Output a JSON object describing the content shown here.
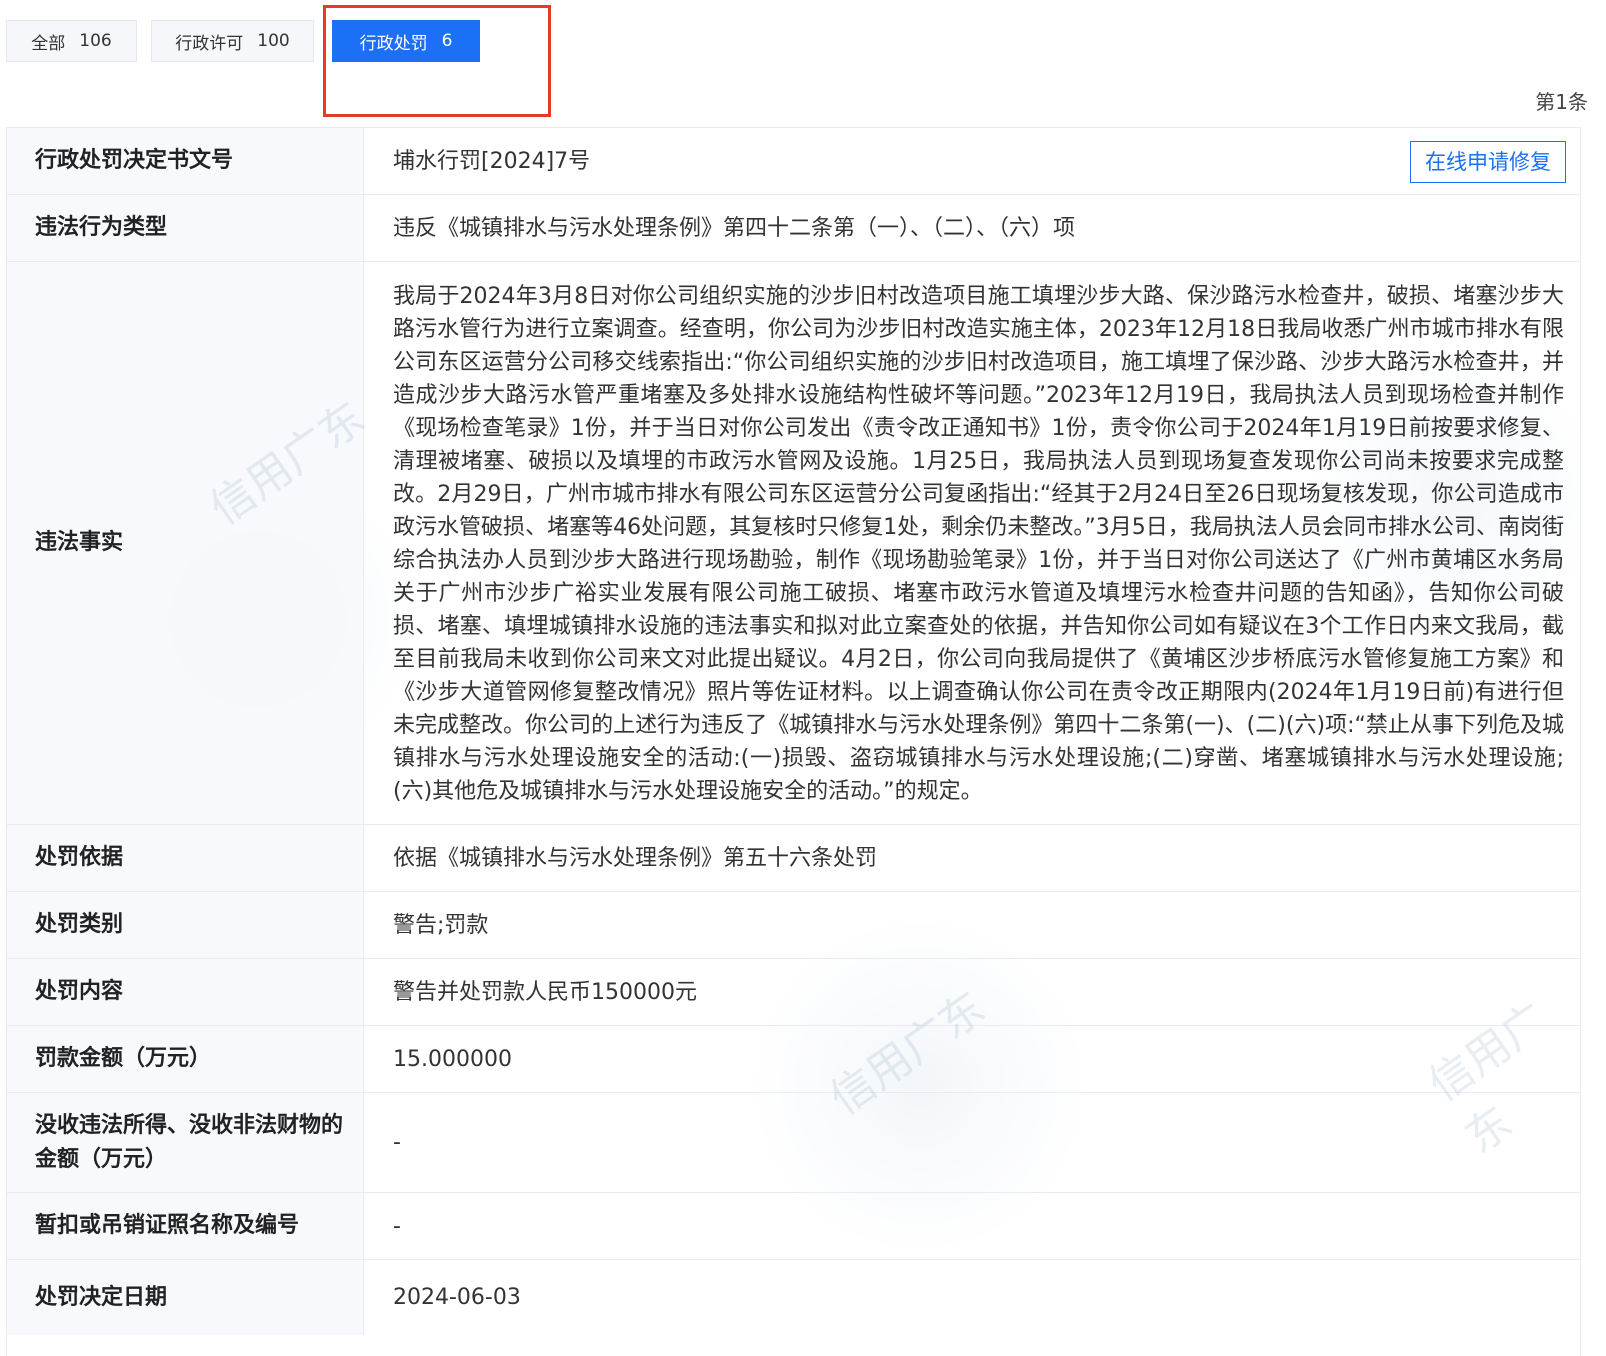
{
  "tabs": [
    {
      "label": "全部",
      "count": "106"
    },
    {
      "label": "行政许可",
      "count": "100"
    },
    {
      "label": "行政处罚",
      "count": "6",
      "active": true
    }
  ],
  "record_count": "第1条",
  "repair_button": "在线申请修复",
  "watermark_text": "信用广东",
  "rows": [
    {
      "label": "行政处罚决定书文号",
      "value": "埔水行罚[2024]7号"
    },
    {
      "label": "违法行为类型",
      "value": "违反《城镇排水与污水处理条例》第四十二条第（一）、（二）、（六）项"
    },
    {
      "label": "违法事实",
      "value": "我局于2024年3月8日对你公司组织实施的沙步旧村改造项目施工填埋沙步大路、保沙路污水检查井，破损、堵塞沙步大路污水管行为进行立案调查。经查明，你公司为沙步旧村改造实施主体，2023年12月18日我局收悉广州市城市排水有限公司东区运营分公司移交线索指出:“你公司组织实施的沙步旧村改造项目，施工填埋了保沙路、沙步大路污水检查井，并造成沙步大路污水管严重堵塞及多处排水设施结构性破坏等问题。”2023年12月19日，我局执法人员到现场检查并制作《现场检查笔录》1份，并于当日对你公司发出《责令改正通知书》1份，责令你公司于2024年1月19日前按要求修复、清理被堵塞、破损以及填埋的市政污水管网及设施。1月25日，我局执法人员到现场复查发现你公司尚未按要求完成整改。2月29日，广州市城市排水有限公司东区运营分公司复函指出:“经其于2月24日至26日现场复核发现，你公司造成市政污水管破损、堵塞等46处问题，其复核时只修复1处，剩余仍未整改。”3月5日，我局执法人员会同市排水公司、南岗街综合执法办人员到沙步大路进行现场勘验，制作《现场勘验笔录》1份，并于当日对你公司送达了《广州市黄埔区水务局关于广州市沙步广裕实业发展有限公司施工破损、堵塞市政污水管道及填埋污水检查井问题的告知函》，告知你公司破损、堵塞、填埋城镇排水设施的违法事实和拟对此立案查处的依据，并告知你公司如有疑议在3个工作日内来文我局，截至目前我局未收到你公司来文对此提出疑议。4月2日，你公司向我局提供了《黄埔区沙步桥底污水管修复施工方案》和《沙步大道管网修复整改情况》照片等佐证材料。以上调查确认你公司在责令改正期限内(2024年1月19日前)有进行但未完成整改。你公司的上述行为违反了《城镇排水与污水处理条例》第四十二条第(一)、(二)(六)项:“禁止从事下列危及城镇排水与污水处理设施安全的活动:(一)损毁、盗窃城镇排水与污水处理设施;(二)穿凿、堵塞城镇排水与污水处理设施;(六)其他危及城镇排水与污水处理设施安全的活动。”的规定。"
    },
    {
      "label": "处罚依据",
      "value": "依据《城镇排水与污水处理条例》第五十六条处罚"
    },
    {
      "label": "处罚类别",
      "value": "警告;罚款"
    },
    {
      "label": "处罚内容",
      "value": "警告并处罚款人民币150000元"
    },
    {
      "label": "罚款金额（万元）",
      "value": "15.000000"
    },
    {
      "label": "没收违法所得、没收非法财物的金额（万元）",
      "value": "-"
    },
    {
      "label": "暂扣或吊销证照名称及编号",
      "value": "-"
    },
    {
      "label": "处罚决定日期",
      "value": "2024-06-03"
    }
  ]
}
